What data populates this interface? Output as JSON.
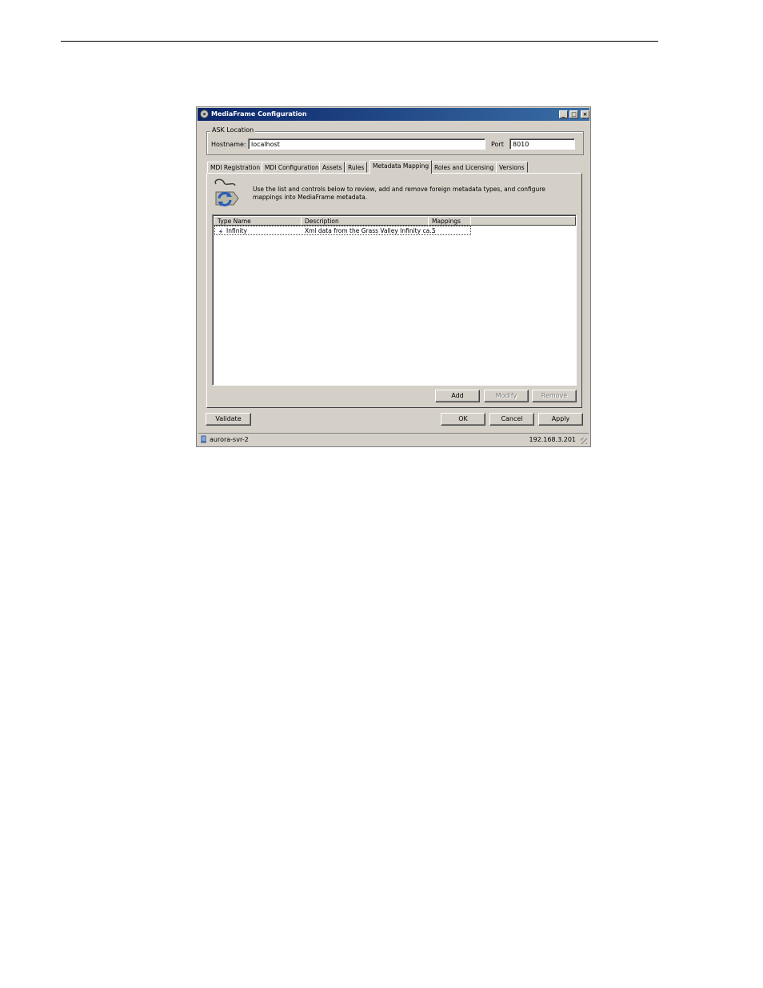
{
  "window": {
    "title": "MediaFrame Configuration",
    "minimize": "_",
    "maximize": "□",
    "close": "×"
  },
  "ask_location": {
    "legend": "ASK Location",
    "hostname_label": "Hostname:",
    "hostname_value": "localhost",
    "port_label": "Port",
    "port_value": "8010"
  },
  "tabs": [
    {
      "label": "MDI Registration"
    },
    {
      "label": "MDI Configuration"
    },
    {
      "label": "Assets"
    },
    {
      "label": "Rules"
    },
    {
      "label": "Metadata Mapping"
    },
    {
      "label": "Roles and Licensing"
    },
    {
      "label": "Versions"
    }
  ],
  "active_tab": "Metadata Mapping",
  "panel": {
    "icon": "metadata-mapping-icon",
    "description": "Use the list and controls below to review, add and remove foreign metadata types, and configure mappings into MediaFrame metadata."
  },
  "list": {
    "columns": [
      "Type Name",
      "Description",
      "Mappings"
    ],
    "rows": [
      {
        "type_name": "Infinity",
        "description": "Xml data from the Grass Valley Infinity ca...",
        "mappings": "5"
      }
    ]
  },
  "list_buttons": {
    "add": "Add",
    "modify": "Modify",
    "remove": "Remove"
  },
  "footer_buttons": {
    "validate": "Validate",
    "ok": "OK",
    "cancel": "Cancel",
    "apply": "Apply"
  },
  "statusbar": {
    "server": "aurora-svr-2",
    "ip": "192.168.3.201"
  }
}
